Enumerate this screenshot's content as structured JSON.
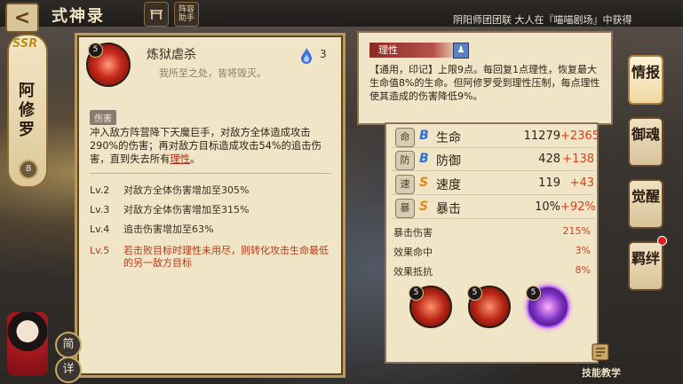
{
  "header": {
    "back_label": "<",
    "title": "式神录",
    "icon_a_label": "",
    "icon_b_label": "阵容助手",
    "news": "阴阳师团团联 大人在『喵喵剧场』中获得"
  },
  "shikigami": {
    "rarity": "SSR",
    "name": "阿修罗",
    "lock_glyph": "8"
  },
  "skill_card": {
    "level_badge": "5",
    "name": "炼狱虐杀",
    "quote": "我所至之处，皆将毁灭。",
    "cost": "3",
    "tag": "伤害",
    "desc_part1": "冲入敌方阵营降下天魔巨手，对敌方全体造成攻击290%的伤害；再对敌方目标造成攻击54%的追击伤害，直到失去所有",
    "desc_keyword": "理性",
    "desc_part2": "。",
    "levels": [
      {
        "lv": "Lv.2",
        "text": "对敌方全体伤害增加至305%"
      },
      {
        "lv": "Lv.3",
        "text": "对敌方全体伤害增加至315%"
      },
      {
        "lv": "Lv.4",
        "text": "追击伤害增加至63%"
      },
      {
        "lv": "Lv.5",
        "text": "若击败目标时理性未用尽，则转化攻击生命最低的另一敌方目标"
      }
    ]
  },
  "tooltip": {
    "title": "理性",
    "text": "【通用，印记】上限9点。每回复1点理性，恢复最大生命值8%的生命。但阿修罗受到理性压制，每点理性使其造成的伤害降低9%。"
  },
  "stats": {
    "rows": [
      {
        "grade": "B",
        "grade_color": "#2a6fd6",
        "name": "生命",
        "value": "11279",
        "bonus": "+2365",
        "icon": "命"
      },
      {
        "grade": "B",
        "grade_color": "#2a6fd6",
        "name": "防御",
        "value": "428",
        "bonus": "+138",
        "icon": "防"
      },
      {
        "grade": "S",
        "grade_color": "#e08a10",
        "name": "速度",
        "value": "119",
        "bonus": "+43",
        "icon": "速"
      },
      {
        "grade": "S",
        "grade_color": "#e08a10",
        "name": "暴击",
        "value": "10%",
        "bonus": "+92%",
        "icon": "暴"
      }
    ],
    "sub": [
      {
        "name": "暴击伤害",
        "value": "215%"
      },
      {
        "name": "效果命中",
        "value": "3%"
      },
      {
        "name": "效果抵抗",
        "value": "8%"
      }
    ],
    "slots": [
      "5",
      "5",
      "5"
    ]
  },
  "right_tabs": [
    "情报",
    "御魂",
    "觉醒",
    "羁绊"
  ],
  "bottom": {
    "teach_label": "技能教学",
    "simple_label": "简",
    "detail_label": "详"
  },
  "colors": {
    "accent_red": "#d3401e",
    "card_bg": "#f1e5c7"
  }
}
